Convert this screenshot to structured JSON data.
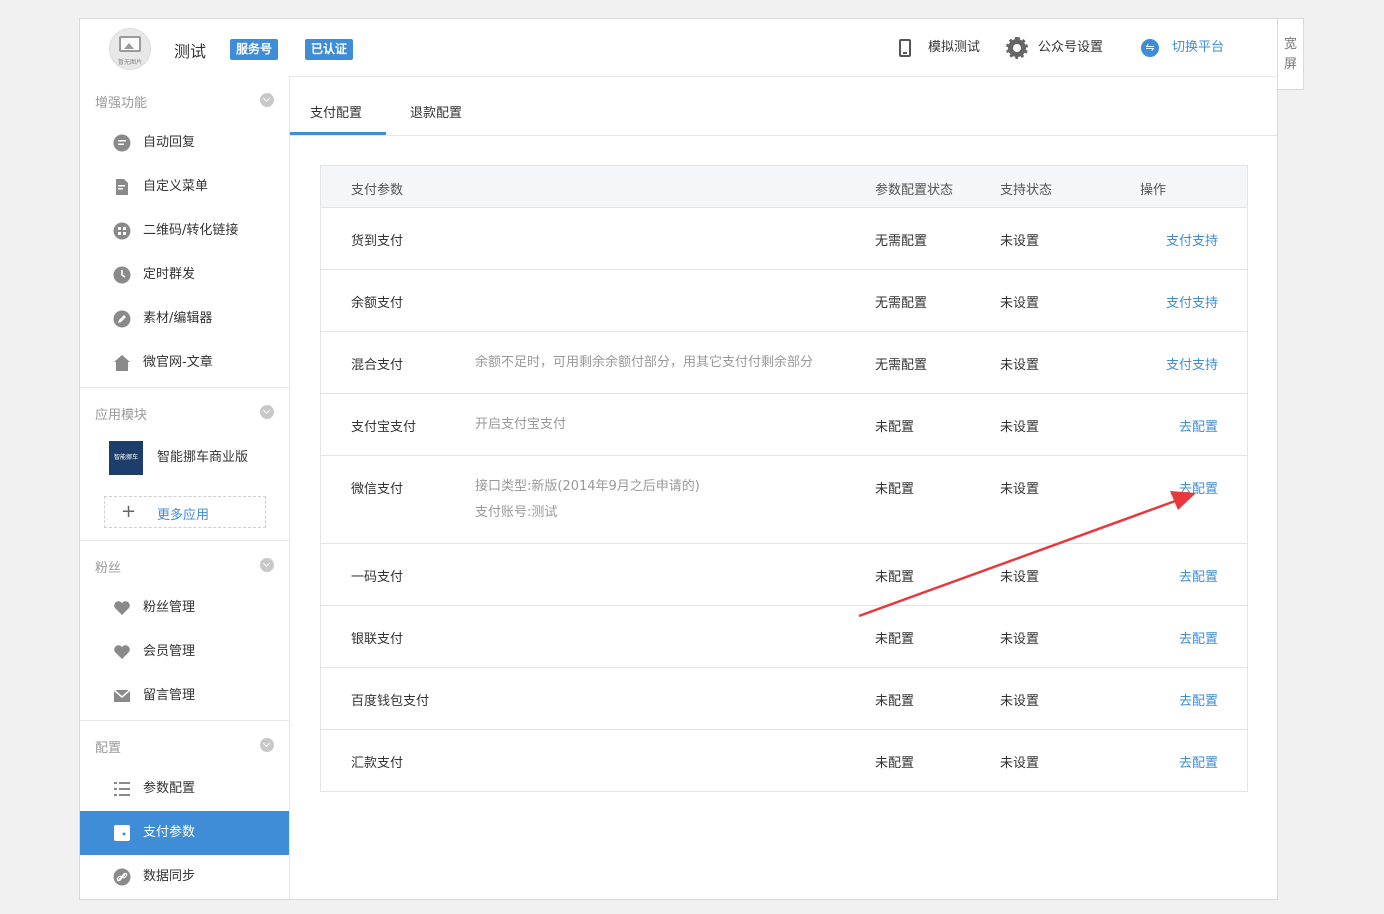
{
  "header": {
    "account_name": "测试",
    "avatar_caption": "暂无图片",
    "badge_service": "服务号",
    "badge_verified": "已认证",
    "simulate_test": "模拟测试",
    "account_settings": "公众号设置",
    "switch_platform": "切换平台",
    "switch_icon": "⇋"
  },
  "wide_screen": "宽屏",
  "sidebar": {
    "enhance_title": "增强功能",
    "enhance_items": [
      "自动回复",
      "自定义菜单",
      "二维码/转化链接",
      "定时群发",
      "素材/编辑器",
      "微官网-文章"
    ],
    "app_title": "应用模块",
    "app_name": "智能挪车商业版",
    "app_logo_text": "智能挪车",
    "more_apps": "更多应用",
    "fans_title": "粉丝",
    "fans_items": [
      "粉丝管理",
      "会员管理",
      "留言管理"
    ],
    "config_title": "配置",
    "config_items": [
      "参数配置",
      "支付参数",
      "数据同步"
    ]
  },
  "tabs": [
    "支付配置",
    "退款配置"
  ],
  "table": {
    "headers": [
      "支付参数",
      "参数配置状态",
      "支持状态",
      "操作"
    ],
    "rows": [
      {
        "name": "货到支付",
        "desc1": "",
        "desc2": "",
        "config": "无需配置",
        "support": "未设置",
        "op": "支付支持"
      },
      {
        "name": "余额支付",
        "desc1": "",
        "desc2": "",
        "config": "无需配置",
        "support": "未设置",
        "op": "支付支持"
      },
      {
        "name": "混合支付",
        "desc1": "余额不足时，可用剩余余额付部分，用其它支付付剩余部分",
        "desc2": "",
        "config": "无需配置",
        "support": "未设置",
        "op": "支付支持"
      },
      {
        "name": "支付宝支付",
        "desc1": "开启支付宝支付",
        "desc2": "",
        "config": "未配置",
        "support": "未设置",
        "op": "去配置"
      },
      {
        "name": "微信支付",
        "desc1": "接口类型:新版(2014年9月之后申请的)",
        "desc2": "支付账号:测试",
        "config": "未配置",
        "support": "未设置",
        "op": "去配置"
      },
      {
        "name": "一码支付",
        "desc1": "",
        "desc2": "",
        "config": "未配置",
        "support": "未设置",
        "op": "去配置"
      },
      {
        "name": "银联支付",
        "desc1": "",
        "desc2": "",
        "config": "未配置",
        "support": "未设置",
        "op": "去配置"
      },
      {
        "name": "百度钱包支付",
        "desc1": "",
        "desc2": "",
        "config": "未配置",
        "support": "未设置",
        "op": "去配置"
      },
      {
        "name": "汇款支付",
        "desc1": "",
        "desc2": "",
        "config": "未配置",
        "support": "未设置",
        "op": "去配置"
      }
    ]
  },
  "colors": {
    "accent": "#3f8dd6",
    "annotation_arrow": "#e8383d"
  }
}
